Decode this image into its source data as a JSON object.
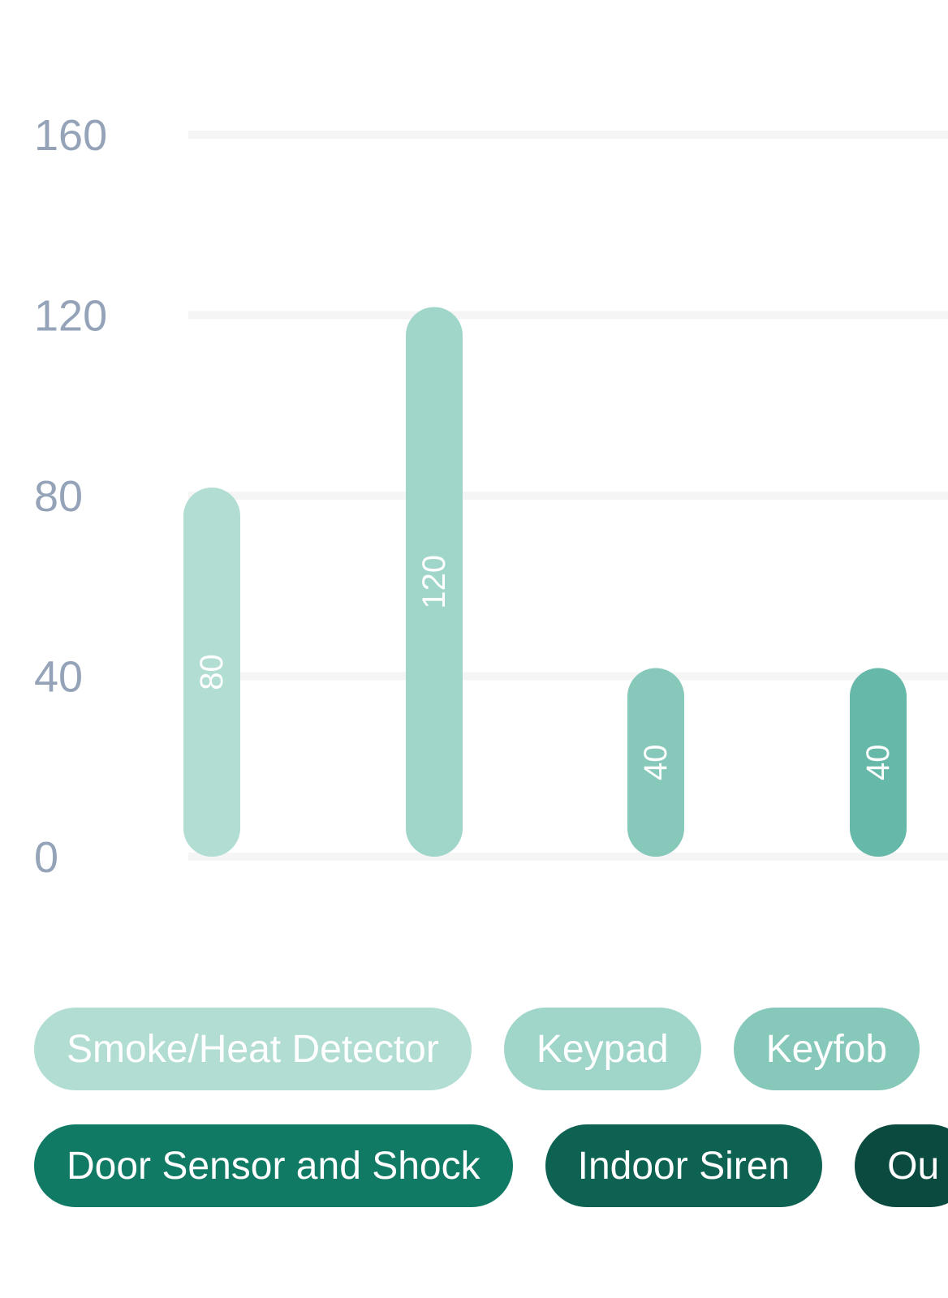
{
  "chart_data": {
    "type": "bar",
    "orientation": "vertical",
    "categories": [
      "Smoke/Heat Detector",
      "Keypad",
      "Keyfob",
      "Door Sensor and Shock"
    ],
    "values": [
      80,
      120,
      40,
      40
    ],
    "value_labels": [
      "80",
      "120",
      "40",
      "40"
    ],
    "bar_colors": [
      "#b2ddd3",
      "#a0d5ca",
      "#86c8b9",
      "#66b8a8"
    ],
    "ylim": [
      0,
      160
    ],
    "y_ticks": [
      0,
      40,
      80,
      120,
      160
    ],
    "y_tick_labels": [
      "0",
      "40",
      "80",
      "120",
      "160"
    ],
    "grid": true,
    "grid_color": "#f5f5f5",
    "axis_text_color": "#94a3b8",
    "title": "",
    "xlabel": "",
    "ylabel": "",
    "legend_position": "bottom",
    "legend": [
      {
        "label": "Smoke/Heat Detector",
        "color": "#b2ddd3"
      },
      {
        "label": "Keypad",
        "color": "#a0d5ca"
      },
      {
        "label": "Keyfob",
        "color": "#86c8b9"
      },
      {
        "label": "Door Sensor and Shock",
        "color": "#117a65"
      },
      {
        "label": "Indoor Siren",
        "color": "#0e6252"
      },
      {
        "label": "Ou",
        "color": "#0b4a3e"
      }
    ]
  }
}
